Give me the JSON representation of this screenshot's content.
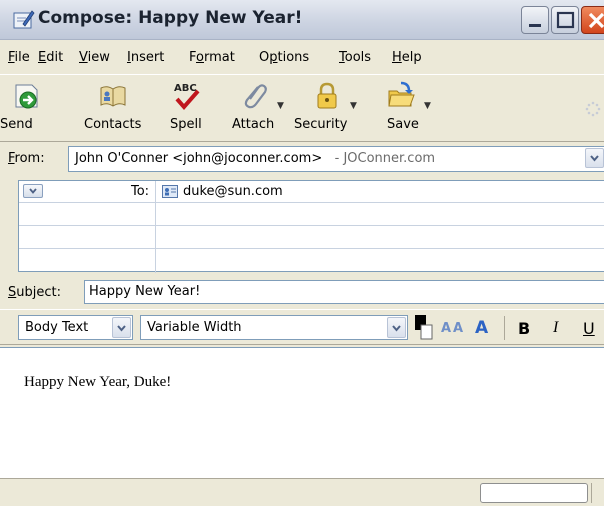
{
  "window": {
    "title": "Compose: Happy New Year!"
  },
  "menu": [
    {
      "pre": "",
      "ul": "F",
      "post": "ile"
    },
    {
      "pre": "",
      "ul": "E",
      "post": "dit"
    },
    {
      "pre": "",
      "ul": "V",
      "post": "iew"
    },
    {
      "pre": "",
      "ul": "I",
      "post": "nsert"
    },
    {
      "pre": "F",
      "ul": "o",
      "post": "rmat"
    },
    {
      "pre": "O",
      "ul": "p",
      "post": "tions"
    },
    {
      "pre": "",
      "ul": "T",
      "post": "ools"
    },
    {
      "pre": "",
      "ul": "H",
      "post": "elp"
    }
  ],
  "toolbar": {
    "send": "Send",
    "contacts": "Contacts",
    "spell": "Spell",
    "spell_icon_text": "ABC",
    "attach": "Attach",
    "security": "Security",
    "save": "Save"
  },
  "from": {
    "label_ul": "F",
    "label_rest": "rom:",
    "value": "John O'Conner <john@joconner.com>",
    "account": "- JOConner.com"
  },
  "addressing": {
    "type": "To:",
    "value": "duke@sun.com"
  },
  "subject": {
    "label_ul": "S",
    "label_rest": "ubject:",
    "value": "Happy New Year!"
  },
  "format": {
    "paragraph_style": "Body Text",
    "font": "Variable Width",
    "bold": "B",
    "italic": "I",
    "underline": "U",
    "smaller_font": "A",
    "larger_font": "A"
  },
  "body": {
    "text": "Happy New Year, Duke!"
  },
  "colors": {
    "accent": "#3a5b9c",
    "close_button": "#d2451c"
  }
}
